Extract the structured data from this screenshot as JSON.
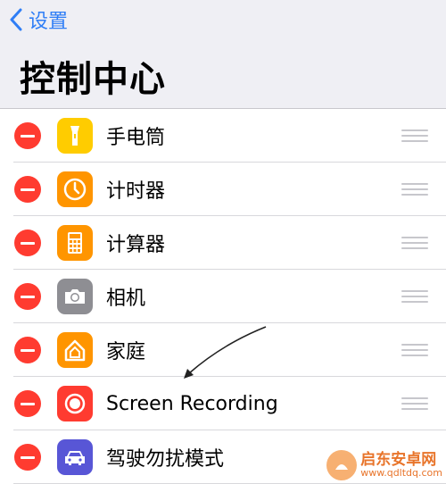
{
  "nav": {
    "back_label": "设置"
  },
  "title": "控制中心",
  "items": [
    {
      "label": "手电筒",
      "icon": "flashlight-icon",
      "color": "#ffcc00"
    },
    {
      "label": "计时器",
      "icon": "timer-icon",
      "color": "#ff9500"
    },
    {
      "label": "计算器",
      "icon": "calculator-icon",
      "color": "#ff9500"
    },
    {
      "label": "相机",
      "icon": "camera-icon",
      "color": "#8e8e93"
    },
    {
      "label": "家庭",
      "icon": "home-icon",
      "color": "#ff9500"
    },
    {
      "label": "Screen Recording",
      "icon": "screen-recording-icon",
      "color": "#ff3b30"
    },
    {
      "label": "驾驶勿扰模式",
      "icon": "car-icon",
      "color": "#5856d6"
    }
  ],
  "watermark": {
    "name": "启东安卓网",
    "url": "www.qdltdq.com"
  },
  "colors": {
    "accent": "#2f7ef6",
    "delete": "#ff3b30",
    "background": "#efeff4"
  }
}
